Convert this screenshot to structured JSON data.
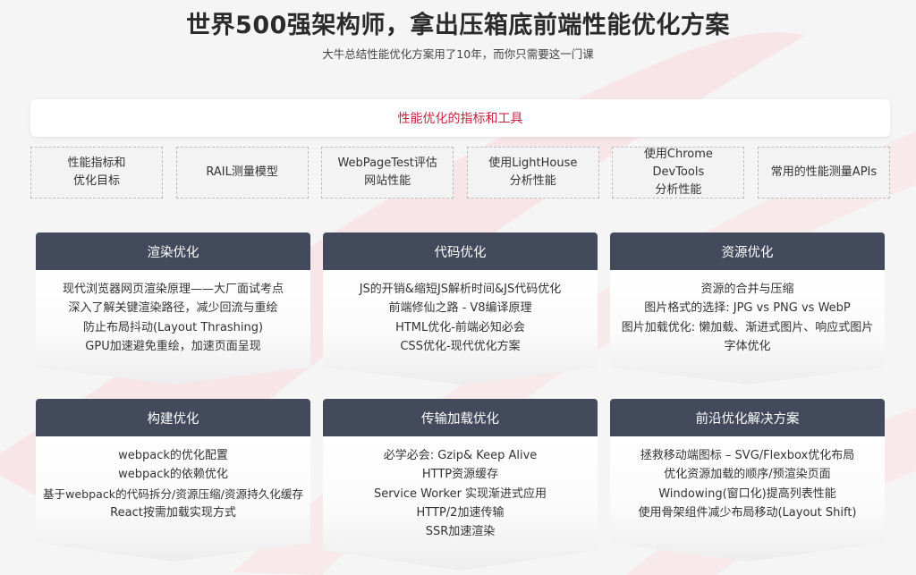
{
  "header": {
    "title": "世界500强架构师，拿出压箱底前端性能优化方案",
    "subtitle": "大牛总结性能优化方案用了10年，而你只需要这一门课"
  },
  "metrics_banner": {
    "label": "性能优化的指标和工具"
  },
  "tools": [
    {
      "label": "性能指标和\n优化目标"
    },
    {
      "label": "RAIL测量模型"
    },
    {
      "label": "WebPageTest评估\n网站性能"
    },
    {
      "label": "使用LightHouse\n分析性能"
    },
    {
      "label": "使用Chrome DevTools\n分析性能"
    },
    {
      "label": "常用的性能测量APIs"
    }
  ],
  "cards": [
    {
      "title": "渲染优化",
      "items": [
        "现代浏览器网页渲染原理——大厂面试考点",
        "深入了解关键渲染路径，减少回流与重绘",
        "防止布局抖动(Layout Thrashing)",
        "GPU加速避免重绘，加速页面呈现"
      ]
    },
    {
      "title": "代码优化",
      "items": [
        "JS的开销&缩短JS解析时间&JS代码优化",
        "前端修仙之路 - V8编译原理",
        "HTML优化-前端必知必会",
        "CSS优化-现代优化方案"
      ]
    },
    {
      "title": "资源优化",
      "items": [
        "资源的合并与压缩",
        "图片格式的选择: JPG vs PNG vs WebP",
        "图片加载优化: 懒加载、渐进式图片、响应式图片",
        "字体优化"
      ]
    },
    {
      "title": "构建优化",
      "items": [
        "webpack的优化配置",
        "webpack的依赖优化",
        "基于webpack的代码拆分/资源压缩/资源持久化缓存",
        "React按需加载实现方式"
      ]
    },
    {
      "title": "传输加载优化",
      "items": [
        "必学必会: Gzip& Keep Alive",
        "HTTP资源缓存",
        "Service Worker 实现渐进式应用",
        "HTTP/2加速传输",
        "SSR加速渲染"
      ]
    },
    {
      "title": "前沿优化解决方案",
      "items": [
        "拯救移动端图标 – SVG/Flexbox优化布局",
        "优化资源加载的顺序/预渲染页面",
        "Windowing(窗口化)提高列表性能",
        "使用骨架组件减少布局移动(Layout Shift)"
      ]
    }
  ],
  "colors": {
    "card_header": "#434a5c",
    "banner_text": "#c8243f",
    "background": "#f5f5f6",
    "accent_swoosh": "#f7d9dc"
  }
}
